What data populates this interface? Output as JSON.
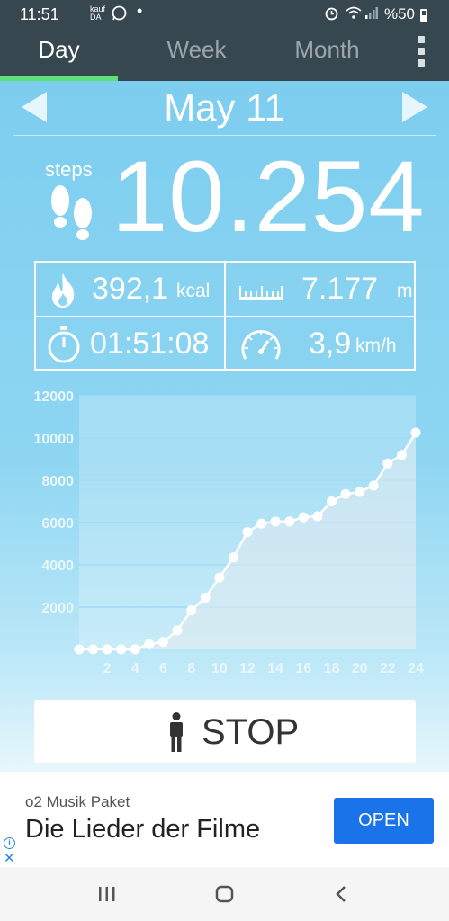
{
  "status_bar": {
    "time": "11:51",
    "notif_icons": [
      "kaufda-icon",
      "whatsapp-icon",
      "dot-icon"
    ],
    "battery_text": "%50"
  },
  "tabs": [
    {
      "label": "Day",
      "active": true
    },
    {
      "label": "Week",
      "active": false
    },
    {
      "label": "Month",
      "active": false
    }
  ],
  "date": "May 11",
  "steps": {
    "label": "steps",
    "value": "10.254"
  },
  "stats": {
    "calories": {
      "value": "392,1",
      "unit": "kcal"
    },
    "distance": {
      "value": "7.177",
      "unit": "m"
    },
    "duration": {
      "value": "01:51:08"
    },
    "speed": {
      "value": "3,9",
      "unit": "km/h"
    }
  },
  "colors": {
    "header_bg": "#37474f",
    "tab_indicator": "#5de07a",
    "ad_button": "#1a73e8"
  },
  "chart_data": {
    "type": "area",
    "x": [
      0,
      1,
      2,
      3,
      4,
      5,
      6,
      7,
      8,
      9,
      10,
      11,
      12,
      13,
      14,
      15,
      16,
      17,
      18,
      19,
      20,
      21,
      22,
      23,
      24
    ],
    "series": [
      {
        "values": [
          0,
          0,
          0,
          0,
          0,
          250,
          350,
          900,
          1850,
          2450,
          3400,
          4350,
          5550,
          5950,
          6050,
          6050,
          6250,
          6300,
          7000,
          7350,
          7450,
          7750,
          8800,
          9200,
          10254
        ]
      }
    ],
    "x_ticks": [
      2,
      4,
      6,
      8,
      10,
      12,
      14,
      16,
      18,
      20,
      22,
      24
    ],
    "y_ticks": [
      2000,
      4000,
      6000,
      8000,
      10000,
      12000
    ],
    "ylim": [
      0,
      12000
    ],
    "xlim": [
      0,
      24
    ],
    "grid": true
  },
  "stop_button": {
    "label": "STOP"
  },
  "ad": {
    "advertiser": "o2 Musik Paket",
    "headline": "Die Lieder der Filme",
    "cta": "OPEN"
  },
  "nav": [
    "recents",
    "home",
    "back"
  ]
}
